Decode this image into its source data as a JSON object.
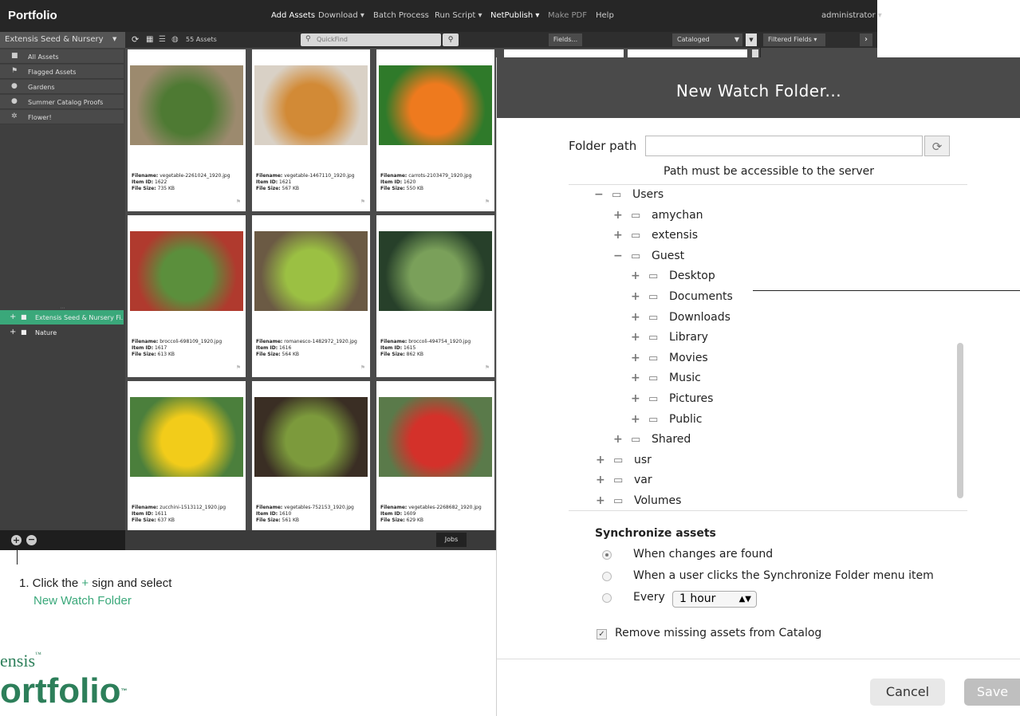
{
  "app": {
    "brand": "Portfolio",
    "menu": [
      "Add Assets",
      "Download ▾",
      "Batch Process",
      "Run Script ▾",
      "NetPublish ▾",
      "Make PDF",
      "Help"
    ],
    "user": "administrator ▾",
    "catalog": "Extensis Seed & Nursery",
    "asset_count": "55 Assets",
    "quickfind_placeholder": "QuickFind",
    "fields_button": "Fields...",
    "view_select": "Cataloged",
    "filtered_fields": "Filtered Fields ▾",
    "jobs_button": "Jobs"
  },
  "sidebar": {
    "items": [
      "All Assets",
      "Flagged Assets",
      "Gardens",
      "Summer Catalog Proofs",
      "Flower!"
    ],
    "folders": [
      "Extensis Seed & Nursery Fi...",
      "Nature"
    ]
  },
  "tiles": [
    {
      "filename": "vegetable-2261024_1920.jpg",
      "item_id": "1622",
      "size": "735 KB"
    },
    {
      "filename": "vegetable-1467110_1920.jpg",
      "item_id": "1621",
      "size": "567 KB"
    },
    {
      "filename": "carrots-2103479_1920.jpg",
      "item_id": "1620",
      "size": "550 KB"
    },
    {
      "filename": "broccoli-698109_1920.jpg",
      "item_id": "1617",
      "size": "613 KB"
    },
    {
      "filename": "romanesco-1482972_1920.jpg",
      "item_id": "1616",
      "size": "564 KB"
    },
    {
      "filename": "broccoli-494754_1920.jpg",
      "item_id": "1615",
      "size": "862 KB"
    },
    {
      "filename": "zucchini-1513112_1920.jpg",
      "item_id": "1611",
      "size": "637 KB"
    },
    {
      "filename": "vegetables-752153_1920.jpg",
      "item_id": "1610",
      "size": "561 KB"
    },
    {
      "filename": "vegetables-2268682_1920.jpg",
      "item_id": "1609",
      "size": "629 KB"
    }
  ],
  "labels": {
    "filename": "Filename:",
    "item_id": "Item ID:",
    "file_size": "File Size:"
  },
  "dialog": {
    "title": "New Watch Folder...",
    "folder_path_label": "Folder path",
    "folder_path_value": "",
    "path_hint": "Path must be accessible to the server",
    "tree": [
      {
        "toggle": "−",
        "name": "Users"
      },
      {
        "toggle": "+",
        "name": "amychan"
      },
      {
        "toggle": "+",
        "name": "extensis"
      },
      {
        "toggle": "−",
        "name": "Guest"
      },
      {
        "toggle": "+",
        "name": "Desktop"
      },
      {
        "toggle": "+",
        "name": "Documents"
      },
      {
        "toggle": "+",
        "name": "Downloads"
      },
      {
        "toggle": "+",
        "name": "Library"
      },
      {
        "toggle": "+",
        "name": "Movies"
      },
      {
        "toggle": "+",
        "name": "Music"
      },
      {
        "toggle": "+",
        "name": "Pictures"
      },
      {
        "toggle": "+",
        "name": "Public"
      },
      {
        "toggle": "+",
        "name": "Shared"
      },
      {
        "toggle": "+",
        "name": "usr"
      },
      {
        "toggle": "+",
        "name": "var"
      },
      {
        "toggle": "+",
        "name": "Volumes"
      }
    ],
    "sync_heading": "Synchronize assets",
    "sync_options": [
      "When changes are found",
      "When a user clicks the Synchronize Folder menu item",
      "Every"
    ],
    "interval": "1 hour",
    "remove_missing": "Remove missing assets from Catalog",
    "cancel": "Cancel",
    "save": "Save"
  },
  "annotation": {
    "step_prefix": "1. Click the ",
    "plus": "+",
    "step_suffix": " sign and select",
    "target": "New Watch Folder"
  },
  "logo": {
    "top": "ensis",
    "bottom": "ortfolio",
    "tm": "™"
  },
  "colors": {
    "accent_green": "#3aa87a",
    "header_dark": "#262626",
    "dialog_header": "#4a4a4a",
    "logo_green": "#2d7f5a"
  }
}
